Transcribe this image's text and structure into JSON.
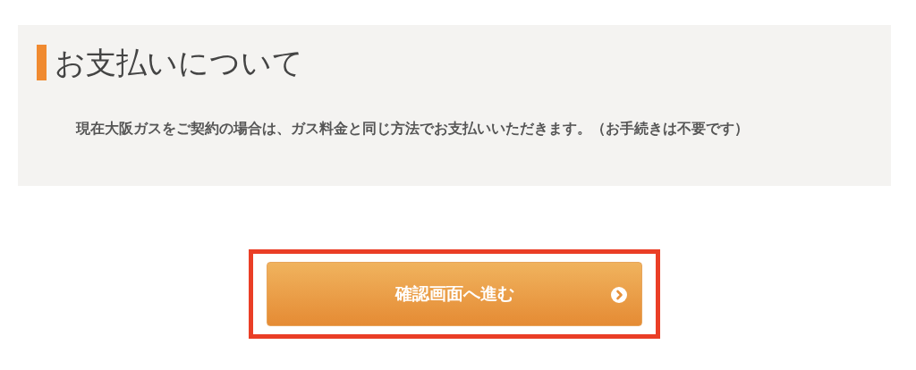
{
  "section": {
    "title": "お支払いについて",
    "body": "現在大阪ガスをご契約の場合は、ガス料金と同じ方法でお支払いいただきます。（お手続きは不要です）"
  },
  "button": {
    "label": "確認画面へ進む",
    "highlighted": true
  }
}
